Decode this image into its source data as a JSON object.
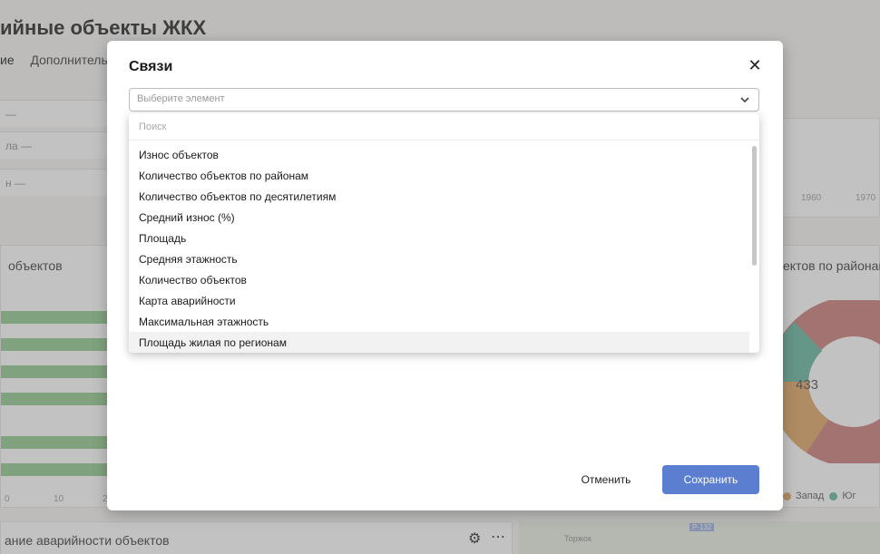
{
  "background": {
    "page_title": "ийные объекты ЖКХ",
    "tabs": [
      "ие",
      "Дополнитель"
    ],
    "filters": [
      "ла —",
      "н —"
    ],
    "card_left_title": "объектов",
    "card_right_title": "ектов по районам",
    "card_bottom_title": "ание аварийности объектов",
    "axis_ticks_left": [
      "0",
      "10",
      "2"
    ],
    "axis_ticks_top": [
      "1960",
      "1970"
    ],
    "donut_total": "433",
    "legend": [
      {
        "label": "Запад",
        "color": "#e0a35e"
      },
      {
        "label": "Юг",
        "color": "#5fb39a"
      }
    ],
    "map_labels": [
      "Торжок",
      "Р-132"
    ],
    "bottom_tools": {
      "settings_icon": "gear-icon",
      "more_icon": "more-icon"
    }
  },
  "dialog": {
    "title": "Связи",
    "close_icon": "close-icon",
    "select": {
      "placeholder": "Выберите элемент",
      "icon": "chevron-down-icon"
    },
    "dropdown": {
      "search_placeholder": "Поиск",
      "items": [
        "Износ объектов",
        "Количество объектов по районам",
        "Количество объектов по десятилетиям",
        "Средний износ (%)",
        "Площадь",
        "Средняя этажность",
        "Количество объектов",
        "Карта аварийности",
        "Максимальная этажность",
        "Площадь жилая по регионам"
      ],
      "hovered_index": 9
    },
    "buttons": {
      "cancel": "Отменить",
      "save": "Сохранить"
    },
    "accent_color": "#5b7ed1"
  }
}
